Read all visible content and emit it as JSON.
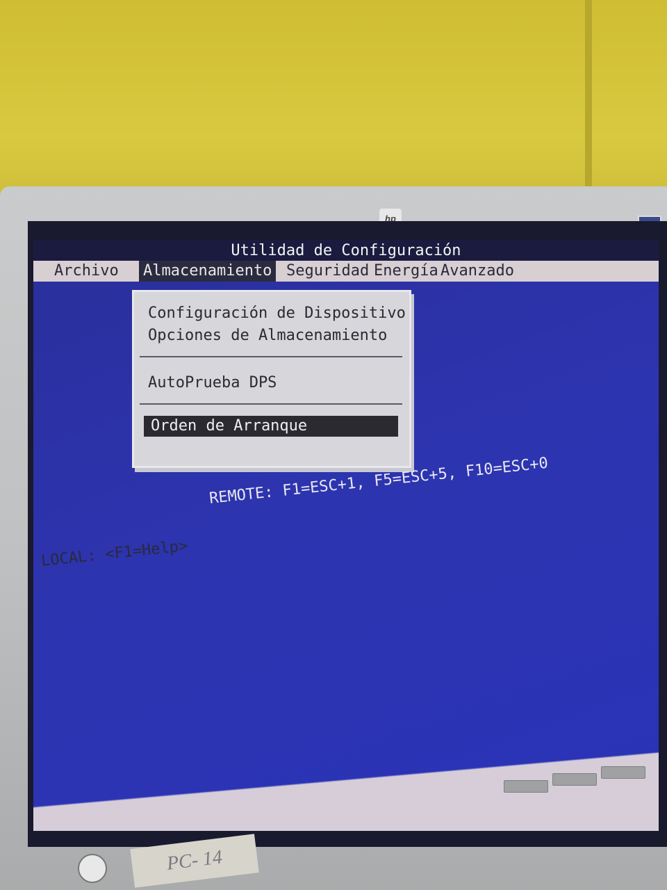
{
  "bios": {
    "title": "Utilidad de Configuración",
    "menu": [
      {
        "label": "Archivo"
      },
      {
        "label": "Almacenamiento"
      },
      {
        "label": "Seguridad"
      },
      {
        "label": "Energía"
      },
      {
        "label": "Avanzado"
      }
    ],
    "active_menu": "Almacenamiento",
    "dropdown": {
      "items": [
        "Configuración de Dispositivo",
        "Opciones de Almacenamiento",
        "AutoPrueba DPS",
        "Orden de Arranque"
      ],
      "selected": "Orden de Arranque"
    },
    "status": {
      "remote": "REMOTE: F1=ESC+1, F5=ESC+5, F10=ESC+0",
      "local": "LOCAL: <F1=Help>"
    }
  },
  "monitor": {
    "brand_logo": "hp",
    "label_sticker": "PC- 14"
  },
  "colors": {
    "bios_background": "#2d34b0",
    "menu_bar": "#d8cfd3",
    "highlight": "#2a2a30",
    "wall": "#d8c83c"
  }
}
